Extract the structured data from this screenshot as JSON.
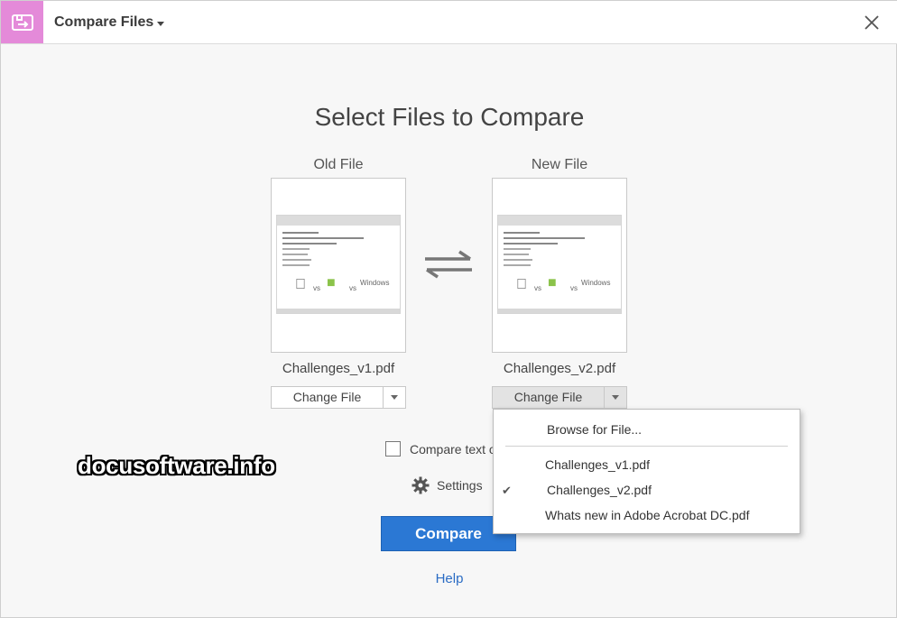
{
  "titlebar": {
    "title": "Compare Files",
    "app_icon": "compare-icon",
    "accent_color": "#e48ad9",
    "close_icon": "close-icon"
  },
  "main": {
    "heading": "Select Files to Compare",
    "old_file": {
      "label": "Old File",
      "filename": "Challenges_v1.pdf",
      "button_label": "Change File"
    },
    "new_file": {
      "label": "New File",
      "filename": "Challenges_v2.pdf",
      "button_label": "Change File"
    },
    "swap_icon": "swap-arrows-icon",
    "compare_text_label": "Compare text o",
    "settings_label": "Settings",
    "compare_button": "Compare",
    "help_link": "Help",
    "accent": "#2b78d4"
  },
  "dropdown": {
    "browse": "Browse for File...",
    "items": [
      {
        "label": "Challenges_v1.pdf",
        "checked": false
      },
      {
        "label": "Challenges_v2.pdf",
        "checked": true
      },
      {
        "label": "Whats new in Adobe Acrobat DC.pdf",
        "checked": false
      }
    ],
    "check_icon": "checkmark-icon"
  },
  "watermark": "docusoftware.info"
}
